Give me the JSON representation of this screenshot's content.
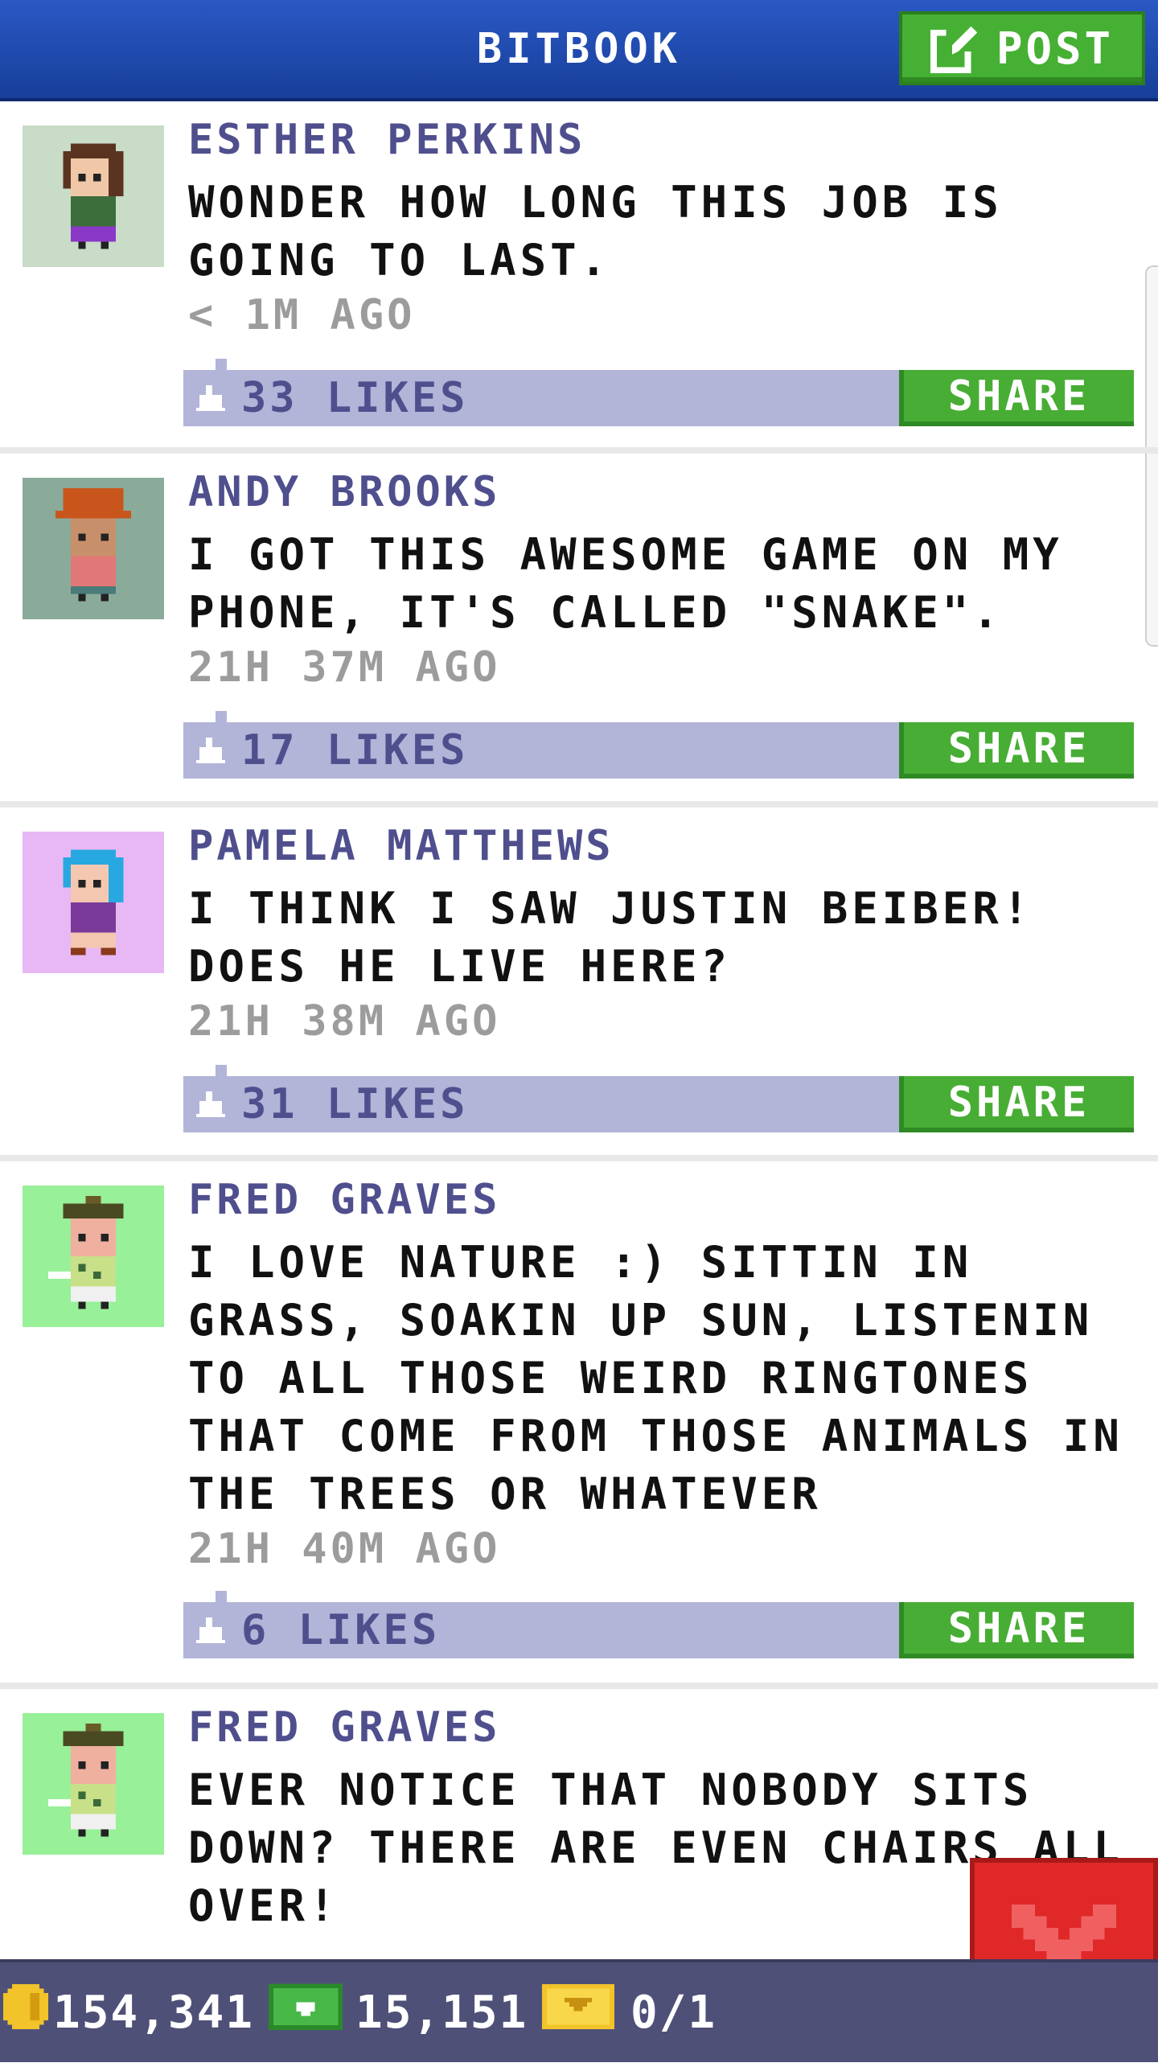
{
  "header": {
    "title": "BITBOOK",
    "post_button": {
      "label": "POST",
      "icon": "compose-icon"
    }
  },
  "posts": [
    {
      "author": "ESTHER PERKINS",
      "message": "WONDER HOW LONG THIS JOB IS GOING TO LAST.",
      "time": "< 1M AGO",
      "likes": "33 LIKES",
      "share_label": "SHARE",
      "avatar_bg": "#c8dcc8"
    },
    {
      "author": "ANDY BROOKS",
      "message": "I GOT THIS AWESOME GAME ON MY PHONE, IT'S CALLED \"SNAKE\".",
      "time": "21H 37M AGO",
      "likes": "17 LIKES",
      "share_label": "SHARE",
      "avatar_bg": "#8aab9a"
    },
    {
      "author": "PAMELA MATTHEWS",
      "message": "I THINK I SAW JUSTIN BEIBER! DOES HE LIVE HERE?",
      "time": "21H 38M AGO",
      "likes": "31 LIKES",
      "share_label": "SHARE",
      "avatar_bg": "#e8b8f4"
    },
    {
      "author": "FRED GRAVES",
      "message": "I LOVE NATURE :) SITTIN IN GRASS, SOAKIN UP SUN, LISTENIN TO ALL THOSE WEIRD RINGTONES THAT COME FROM THOSE ANIMALS IN THE TREES OR WHATEVER",
      "time": "21H 40M AGO",
      "likes": "6 LIKES",
      "share_label": "SHARE",
      "avatar_bg": "#98f098"
    },
    {
      "author": "FRED GRAVES",
      "message": "EVER NOTICE THAT NOBODY SITS DOWN? THERE ARE EVEN CHAIRS ALL OVER!",
      "avatar_bg": "#98f098"
    }
  ],
  "footer": {
    "coins": "154,341",
    "bux": "15,151",
    "tickets": "0/1",
    "icons": [
      "coin-icon",
      "bux-icon",
      "ticket-icon"
    ]
  },
  "close_button": {
    "icon": "close-icon"
  },
  "colors": {
    "header_blue": "#2a58c4",
    "share_green": "#48ad35",
    "like_bar": "#b2b4d8",
    "author_text": "#4f4f8e",
    "close_red": "#e02828",
    "footer_bg": "#4f5078"
  }
}
